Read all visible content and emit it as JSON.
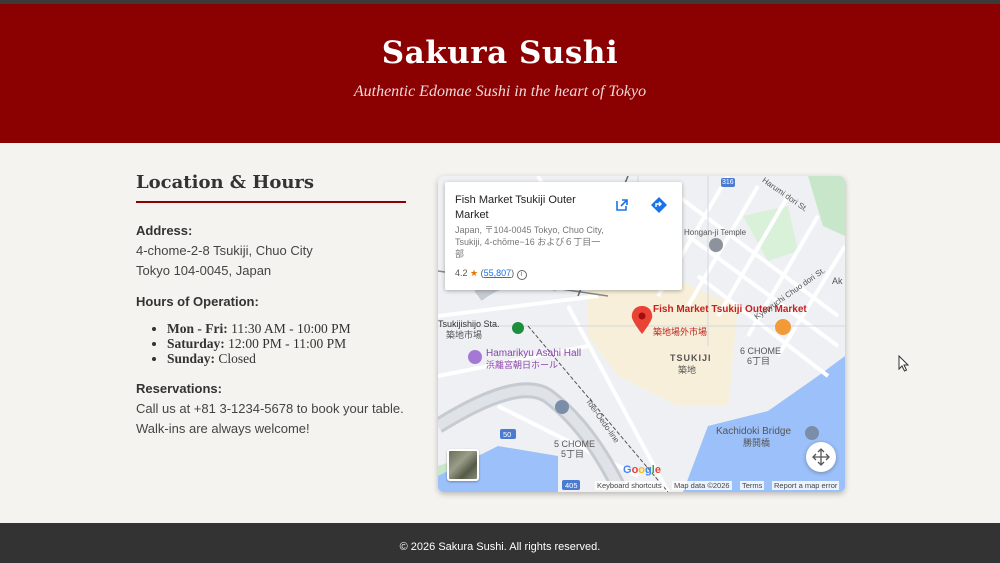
{
  "header": {
    "title": "Sakura Sushi",
    "subtitle": "Authentic Edomae Sushi in the heart of Tokyo"
  },
  "info": {
    "heading": "Location & Hours",
    "address_label": "Address:",
    "address_line1": "4-chome-2-8 Tsukiji, Chuo City",
    "address_line2": "Tokyo 104-0045, Japan",
    "hours_label": "Hours of Operation:",
    "hours": [
      {
        "day": "Mon - Fri:",
        "time": "11:30 AM - 10:00 PM"
      },
      {
        "day": "Saturday:",
        "time": "12:00 PM - 11:00 PM"
      },
      {
        "day": "Sunday:",
        "time": "Closed"
      }
    ],
    "reservations_label": "Reservations:",
    "reservations_line1": "Call us at +81 3-1234-5678 to book your table.",
    "reservations_line2": "Walk-ins are always welcome!"
  },
  "map": {
    "place_title": "Fish Market Tsukiji Outer Market",
    "place_address": "Japan, 〒104-0045 Tokyo, Chuo City, Tsukiji, 4-chōme−16 および６丁目一部",
    "rating": "4.2",
    "review_count": "55,807",
    "labels": {
      "marker_name": "Fish Market Tsukiji Outer Market",
      "marker_name_jp": "築地場外市場",
      "tsukiji": "TSUKIJI",
      "tsukiji_jp": "築地",
      "chome6": "6 CHOME",
      "chome6_jp": "6丁目",
      "chome5": "5 CHOME",
      "chome5_jp": "5丁目",
      "hamarikyu": "Hamarikyu Asahi Hall",
      "hamarikyu_jp": "浜離宮朝日ホール",
      "station": "Tsukijishijo Sta.",
      "station_jp": "築地市場",
      "kachidoki": "Kachidoki Bridge",
      "kachidoki_jp": "勝鬨橋",
      "kyoryuchi": "Kyoryuchi Chuo dori St.",
      "harumi": "Harumi dori St.",
      "toei": "Toei-Oedo-line",
      "temple": "Hongan-ji Temple",
      "route_50a": "50",
      "route_50b": "50",
      "route_405": "405",
      "route_316": "316",
      "ak": "Ak"
    },
    "attribution": {
      "shortcuts": "Keyboard shortcuts",
      "data": "Map data ©2026",
      "terms": "Terms",
      "report": "Report a map error",
      "google": "Google"
    },
    "icons": {
      "open": "open-in-new-icon",
      "directions": "directions-icon",
      "info": "info-icon",
      "zoom": "fullscreen-icon",
      "marker": "map-pin-icon"
    },
    "colors": {
      "pin": "#ea4335",
      "water": "#9cc0f9",
      "park": "#c8e6c9"
    }
  },
  "footer": {
    "text": "© 2026 Sakura Sushi. All rights reserved."
  },
  "colors": {
    "brand": "#8b0000",
    "footer": "#333333",
    "background": "#f5f3ef"
  }
}
